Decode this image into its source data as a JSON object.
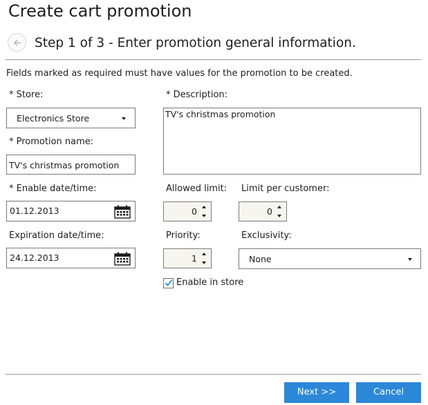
{
  "window": {
    "title": "Create cart promotion"
  },
  "wizard": {
    "step_text": "Step 1 of 3 - Enter promotion general information.",
    "back_icon": "back-arrow-icon"
  },
  "form": {
    "required_note": "Fields marked as required must have values for the promotion to be created.",
    "store": {
      "label": "* Store:",
      "value": "Electronics Store"
    },
    "promotion_name": {
      "label": "* Promotion name:",
      "value": "TV's christmas promotion"
    },
    "description": {
      "label": "* Description:",
      "value": "TV's christmas promotion"
    },
    "enable_date": {
      "label": "* Enable date/time:",
      "value": "01.12.2013",
      "icon": "calendar-icon"
    },
    "expiration_date": {
      "label": "Expiration date/time:",
      "value": "24.12.2013",
      "icon": "calendar-icon"
    },
    "allowed_limit": {
      "label": "Allowed limit:",
      "value": "0"
    },
    "limit_per_customer": {
      "label": "Limit per customer:",
      "value": "0"
    },
    "priority": {
      "label": "Priority:",
      "value": "1"
    },
    "exclusivity": {
      "label": "Exclusivity:",
      "value": "None"
    },
    "enable_in_store": {
      "label": "Enable in store",
      "checked": true
    }
  },
  "footer": {
    "next_label": "Next >>",
    "cancel_label": "Cancel"
  },
  "colors": {
    "accent": "#2b88d8",
    "spin_bg": "#f6f6ee"
  }
}
